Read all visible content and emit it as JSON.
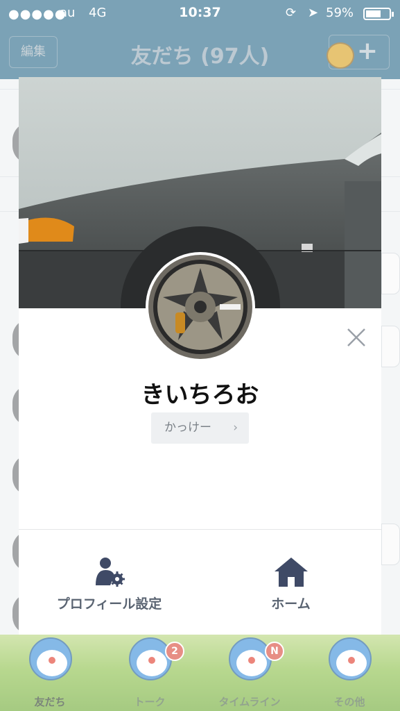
{
  "status_bar": {
    "signal": "●●●●●",
    "carrier": "au",
    "network": "4G",
    "time": "10:37",
    "lock_icon": "⟳",
    "location_icon": "➤",
    "battery": "59%"
  },
  "nav": {
    "edit_label": "編集",
    "title": "友だち (97人)",
    "add_label": "+"
  },
  "profile": {
    "name": "きいちろお",
    "status_message": "かっけー",
    "status_chevron": "›",
    "actions": {
      "profile_settings": "プロフィール設定",
      "home": "ホーム"
    }
  },
  "tabs": [
    {
      "label": "友だち",
      "badge": ""
    },
    {
      "label": "トーク",
      "badge": "2"
    },
    {
      "label": "タイムライン",
      "badge": "N"
    },
    {
      "label": "その他",
      "badge": ""
    }
  ],
  "colors": {
    "nav_bg": "#2b6a8a",
    "action_icon": "#3f4a66",
    "name_text": "#111111"
  }
}
